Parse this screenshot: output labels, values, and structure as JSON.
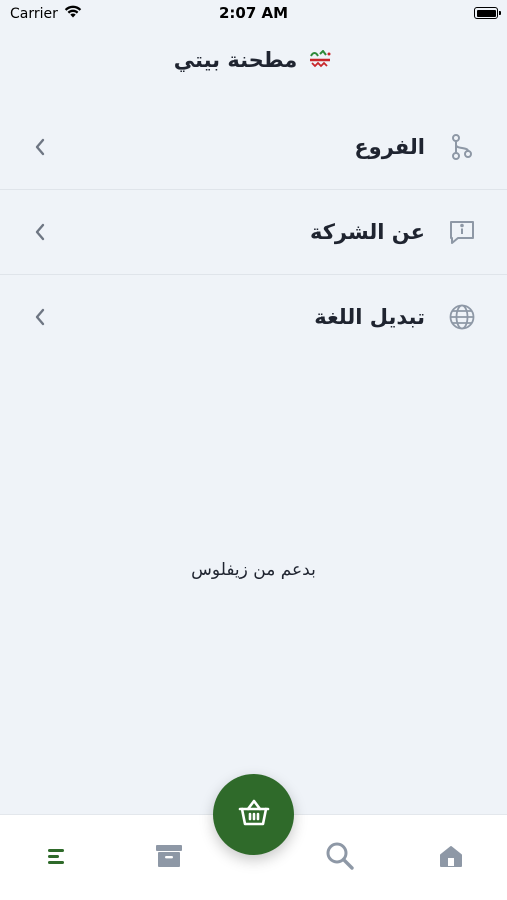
{
  "status_bar": {
    "carrier": "Carrier",
    "time": "2:07 AM"
  },
  "header": {
    "title": "مطحنة بيتي",
    "logo_icon": "brand-logo-icon"
  },
  "menu": {
    "items": [
      {
        "label": "الفروع",
        "icon": "branches-icon"
      },
      {
        "label": "عن الشركة",
        "icon": "info-message-icon"
      },
      {
        "label": "تبديل اللغة",
        "icon": "globe-icon"
      }
    ]
  },
  "footer": {
    "powered_by": "بدعم من زيفلوس"
  },
  "tabbar": {
    "tabs": [
      {
        "icon": "menu-lines-icon",
        "active": true
      },
      {
        "icon": "archive-icon",
        "active": false
      },
      {
        "icon": "basket-icon",
        "active": false
      },
      {
        "icon": "search-icon",
        "active": false
      },
      {
        "icon": "home-icon",
        "active": false
      }
    ]
  },
  "colors": {
    "background": "#eff3f8",
    "accent": "#2f6a2a",
    "icon_gray": "#8e98a6",
    "text": "#1f2430"
  }
}
